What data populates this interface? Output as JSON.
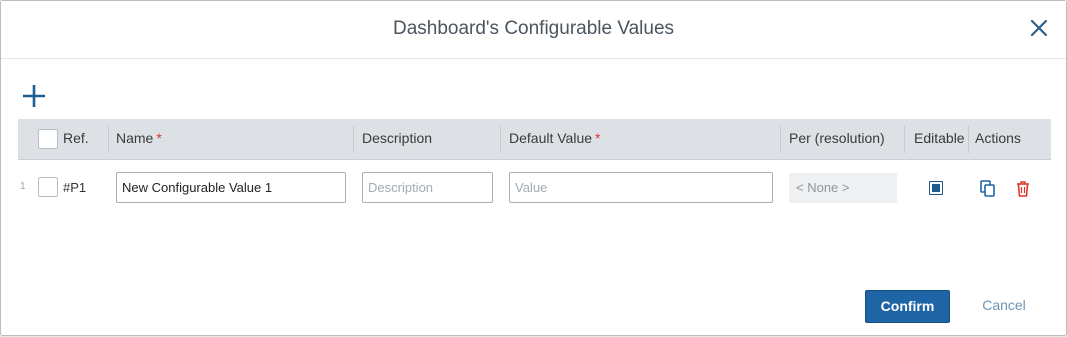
{
  "dialog": {
    "title": "Dashboard's Configurable Values",
    "close_icon": "close-icon",
    "add_icon": "plus-icon"
  },
  "table": {
    "columns": {
      "ref": "Ref.",
      "name": "Name",
      "description": "Description",
      "default_value": "Default Value",
      "per": "Per (resolution)",
      "editable": "Editable",
      "actions": "Actions"
    },
    "required_marker": "*",
    "rows": [
      {
        "index": "1",
        "ref": "#P1",
        "name_value": "New Configurable Value 1",
        "description_placeholder": "Description",
        "value_placeholder": "Value",
        "per": "< None >",
        "editable": true,
        "actions": [
          "copy-icon",
          "trash-icon"
        ]
      }
    ]
  },
  "footer": {
    "confirm_label": "Confirm",
    "cancel_label": "Cancel"
  },
  "colors": {
    "accent": "#1f65a6",
    "required": "#d9382f",
    "delete": "#d9382f"
  }
}
